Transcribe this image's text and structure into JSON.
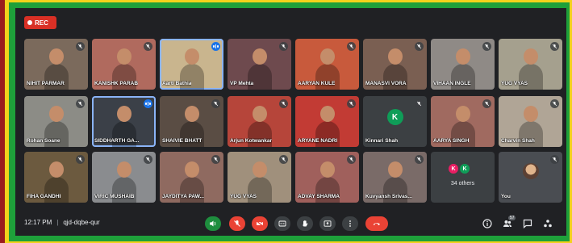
{
  "recording": {
    "label": "REC"
  },
  "participants": [
    {
      "name": "NIHIT PARMAR",
      "bg": "#7b6a5c",
      "muted": true
    },
    {
      "name": "KANISHK PARAB",
      "bg": "#b06a5e",
      "muted": true
    },
    {
      "name": "Aarti Bathia",
      "bg": "#c9b58e",
      "muted": false,
      "speaking": true
    },
    {
      "name": "VP Mehta",
      "bg": "#6e4a4e",
      "muted": true
    },
    {
      "name": "AARYAN KULE",
      "bg": "#c85a3c",
      "muted": true
    },
    {
      "name": "MANASVI VORA",
      "bg": "#7a5f52",
      "muted": true
    },
    {
      "name": "VIHAAN INGLE",
      "bg": "#8f8a86",
      "muted": true
    },
    {
      "name": "YUG VYAS",
      "bg": "#a5a08e",
      "muted": true
    },
    {
      "name": "Rohan Soane",
      "bg": "#8c8c86",
      "muted": true
    },
    {
      "name": "SIDDHARTH GA...",
      "bg": "#3b4048",
      "muted": false,
      "speaking": true
    },
    {
      "name": "SHAIVIE BHATT",
      "bg": "#5a4d44",
      "muted": true
    },
    {
      "name": "Arjun Kotwankar",
      "bg": "#b6453a",
      "muted": true
    },
    {
      "name": "ARYANE NADRI",
      "bg": "#c23b34",
      "muted": true
    },
    {
      "name": "Kinnari Shah",
      "bg": "#3c4043",
      "muted": true,
      "avatar_letter": "K",
      "avatar_color": "#0f9d58"
    },
    {
      "name": "AARYA SINGH",
      "bg": "#a06a60",
      "muted": true
    },
    {
      "name": "Charvin Shah",
      "bg": "#b0a596",
      "muted": true
    },
    {
      "name": "FIHA GANDHI",
      "bg": "#6c5a3f",
      "muted": true
    },
    {
      "name": "VIRIC MUSHAIB",
      "bg": "#8a8c8f",
      "muted": true
    },
    {
      "name": "JAYDITYA PAW...",
      "bg": "#8f6a60",
      "muted": true
    },
    {
      "name": "YUG VYAS",
      "bg": "#a0907c",
      "muted": true
    },
    {
      "name": "ADVAY SHARMA",
      "bg": "#a0605c",
      "muted": true
    },
    {
      "name": "Kuvyansh Srivas...",
      "bg": "#7a6b68",
      "muted": true
    }
  ],
  "others_tile": {
    "label": "34 others",
    "avatars": [
      {
        "letter": "K",
        "color": "#e91e63"
      },
      {
        "letter": "K",
        "color": "#0f9d58"
      }
    ]
  },
  "self_tile": {
    "label": "You"
  },
  "bottom_bar": {
    "time": "12:17 PM",
    "separator": "|",
    "meeting_code": "qjd-dqbe-qur",
    "participant_count": "57"
  },
  "controls": [
    {
      "name": "audio-output-button",
      "icon": "speaker-icon",
      "style": "green"
    },
    {
      "name": "microphone-button",
      "icon": "mic-off-icon",
      "style": "red"
    },
    {
      "name": "camera-button",
      "icon": "camera-off-icon",
      "style": "red"
    },
    {
      "name": "captions-button",
      "icon": "captions-icon",
      "style": "default"
    },
    {
      "name": "raise-hand-button",
      "icon": "hand-icon",
      "style": "default"
    },
    {
      "name": "present-button",
      "icon": "present-icon",
      "style": "default"
    },
    {
      "name": "more-options-button",
      "icon": "more-vert-icon",
      "style": "default"
    },
    {
      "name": "leave-call-button",
      "icon": "hangup-icon",
      "style": "hangup"
    }
  ],
  "right_icons": [
    "info-icon",
    "people-icon",
    "chat-icon",
    "activities-icon"
  ]
}
